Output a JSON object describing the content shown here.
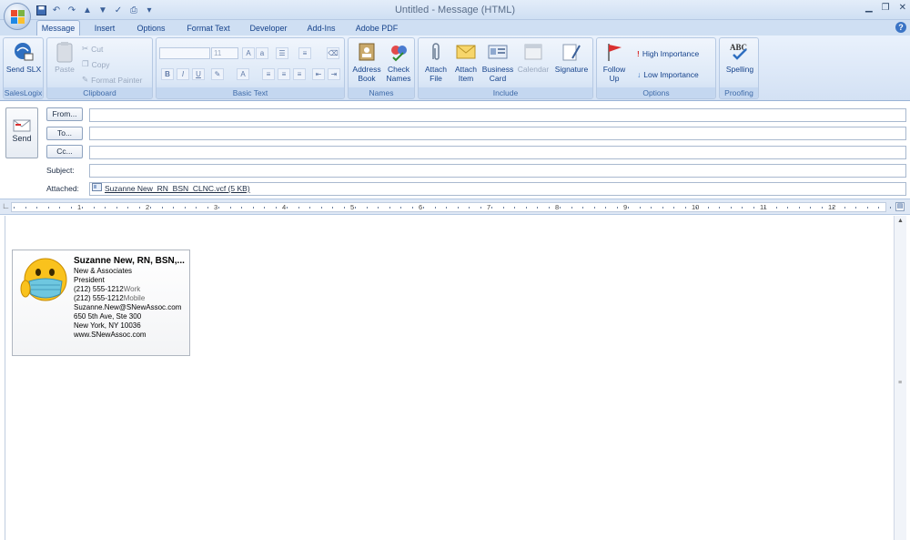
{
  "window": {
    "title": "Untitled - Message (HTML)",
    "controls": [
      "minimize",
      "maximize",
      "close"
    ]
  },
  "tabs": [
    "Message",
    "Insert",
    "Options",
    "Format Text",
    "Developer",
    "Add-Ins",
    "Adobe PDF"
  ],
  "ribbon": {
    "saleslogix": {
      "label": "SalesLogix",
      "send_slx": "Send SLX"
    },
    "clipboard": {
      "label": "Clipboard",
      "paste": "Paste",
      "cut": "Cut",
      "copy": "Copy",
      "format_painter": "Format Painter"
    },
    "basic_text": {
      "label": "Basic Text",
      "font_size": "11",
      "bold": "B",
      "italic": "I",
      "underline": "U"
    },
    "names": {
      "label": "Names",
      "address_book": "Address Book",
      "check_names": "Check Names"
    },
    "include": {
      "label": "Include",
      "attach_file": "Attach File",
      "attach_item": "Attach Item",
      "business_card": "Business Card",
      "calendar": "Calendar",
      "signature": "Signature"
    },
    "options": {
      "label": "Options",
      "follow_up": "Follow Up",
      "high_importance": "High Importance",
      "low_importance": "Low Importance"
    },
    "proofing": {
      "label": "Proofing",
      "spelling": "Spelling"
    }
  },
  "header": {
    "send": "Send",
    "from_btn": "From...",
    "to_btn": "To...",
    "cc_btn": "Cc...",
    "subject_label": "Subject:",
    "attached_label": "Attached:",
    "from_value": "",
    "to_value": "",
    "cc_value": "",
    "subject_value": "",
    "attachment": "Suzanne New_RN_BSN_CLNC.vcf (5 KB)"
  },
  "ruler": {
    "numbers": [
      "1",
      "2",
      "3",
      "4",
      "5",
      "6",
      "7",
      "8",
      "9",
      "10",
      "11",
      "12"
    ]
  },
  "card": {
    "name": "Suzanne New, RN, BSN,...",
    "company": "New & Associates",
    "title": "President",
    "work_phone": "(212) 555-1212",
    "work_label": "Work",
    "mobile_phone": "(212) 555-1212",
    "mobile_label": "Mobile",
    "email": "Suzanne.New@SNewAssoc.com",
    "address1": "650 5th Ave, Ste 300",
    "address2": "New York, NY 10036",
    "web": "www.SNewAssoc.com"
  }
}
